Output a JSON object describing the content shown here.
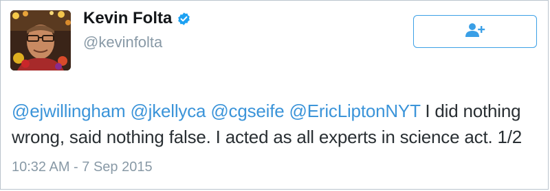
{
  "author": {
    "name": "Kevin Folta",
    "handle": "@kevinfolta",
    "verified": true
  },
  "follow_button": {
    "icon": "add-user-icon",
    "color": "#3a9fe6"
  },
  "tweet": {
    "mentions": [
      "@ejwillingham",
      "@jkellyca",
      "@cgseife",
      "@EricLiptonNYT"
    ],
    "text": "I did nothing wrong, said nothing false. I acted as all experts in science act. 1/2",
    "timestamp": "10:32 AM - 7 Sep 2015"
  },
  "colors": {
    "link": "#3b94d9",
    "muted": "#8899a6",
    "verified": "#1da1f2",
    "border": "#b9c3cc"
  }
}
